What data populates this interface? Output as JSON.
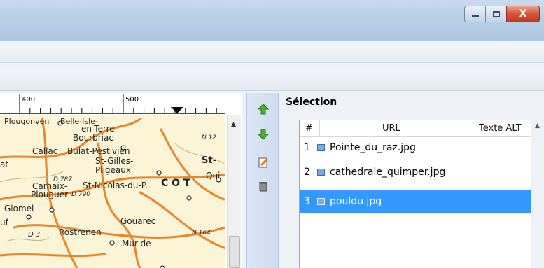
{
  "window": {
    "minimize_icon": "minimize-icon",
    "maximize_icon": "maximize-icon",
    "close_label": "X"
  },
  "ruler": {
    "label_400": "400",
    "label_500": "500"
  },
  "map": {
    "towns": [
      "Plougonven",
      "Belle-Isle-",
      "en-Terre",
      "Bourbriac",
      "Callac",
      "Bulat-Pestivien",
      "St-Gilles-",
      "Pligeaux",
      "Carhaix-",
      "Plouguer",
      "St-Nicolas-du-P.",
      "Glomel",
      "Gouarec",
      "Rostrenen",
      "Mur-de-",
      "St-",
      "Qui",
      "C O T",
      "N 12",
      "D 787",
      "D 790",
      "N 164",
      "D 3",
      "at",
      "uf-"
    ]
  },
  "buttons": {
    "move_up": "move-up-icon",
    "move_down": "move-down-icon",
    "edit": "edit-icon",
    "delete": "trash-icon"
  },
  "selection": {
    "title": "Sélection",
    "columns": [
      "#",
      "URL",
      "Texte ALT"
    ],
    "rows": [
      {
        "num": "1",
        "url": "Pointe_du_raz.jpg",
        "selected": false
      },
      {
        "num": "2",
        "url": "cathedrale_quimper.jpg",
        "selected": false
      },
      {
        "num": "3",
        "url": "pouldu.jpg",
        "selected": true
      }
    ]
  },
  "colors": {
    "selection": "#3399ff",
    "map_bg": "#fbf4d6",
    "roads": "#e8862a"
  }
}
